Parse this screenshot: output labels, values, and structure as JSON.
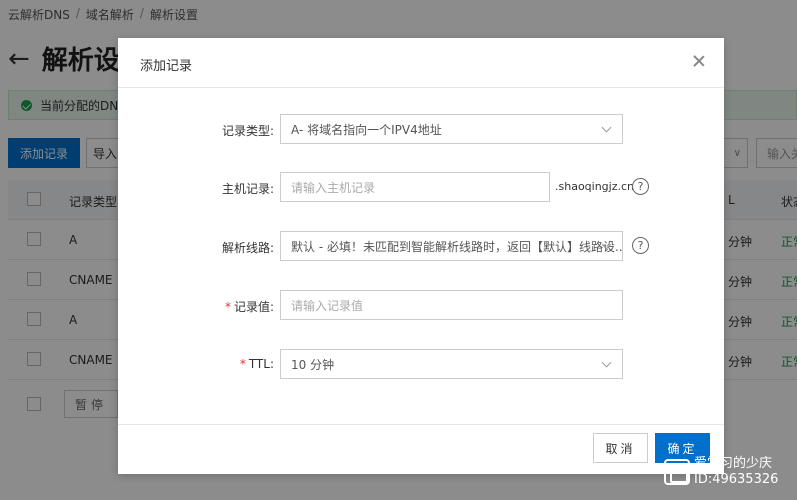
{
  "breadcrumb": [
    "云解析DNS",
    "域名解析",
    "解析设置"
  ],
  "breadcrumb_sep": "/",
  "page": {
    "back_icon": "←",
    "title": "解析设",
    "notice": "当前分配的DNS",
    "add_button": "添加记录",
    "import_button": "导入",
    "filter_chevron": "∨",
    "right_input": "输入关"
  },
  "table": {
    "header": {
      "type": "记录类型",
      "ttl": "L",
      "status": "状态"
    },
    "rows": [
      {
        "type": "A",
        "ttl": "分钟",
        "status": "正常"
      },
      {
        "type": "CNAME",
        "ttl": "分钟",
        "status": "正常"
      },
      {
        "type": "A",
        "ttl": "分钟",
        "status": "正常"
      },
      {
        "type": "CNAME",
        "ttl": "分钟",
        "status": "正常"
      }
    ],
    "pause_button": "暂停"
  },
  "dialog": {
    "title": "添加记录",
    "fields": {
      "record_type": {
        "label": "记录类型:",
        "value": "A- 将域名指向一个IPV4地址"
      },
      "host": {
        "label": "主机记录:",
        "placeholder": "请输入主机记录",
        "suffix": ".shaoqingjz.cn"
      },
      "line": {
        "label": "解析线路:",
        "value": "默认 - 必填！未匹配到智能解析线路时，返回【默认】线路设..."
      },
      "value": {
        "label": "记录值:",
        "placeholder": "请输入记录值",
        "required": "*"
      },
      "ttl": {
        "label": "TTL:",
        "value": "10 分钟",
        "required": "*"
      }
    },
    "help_symbol": "?",
    "cancel": "取消",
    "ok": "确定"
  },
  "watermark": {
    "line1": "爱学习的少庆",
    "line2": "ID:49635326"
  },
  "colors": {
    "primary": "#0070cc",
    "success": "#1a9f4a",
    "required": "#e8333c"
  }
}
